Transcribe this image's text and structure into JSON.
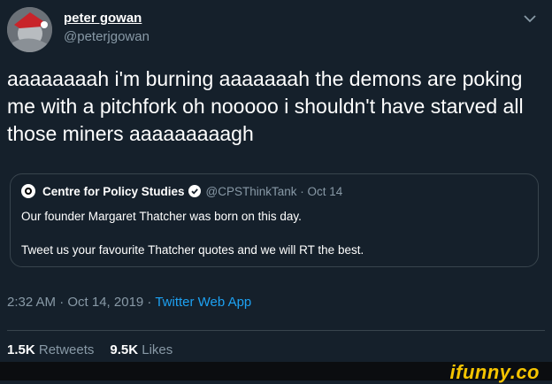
{
  "user": {
    "name": "peter gowan",
    "handle": "@peterjgowan"
  },
  "tweet": {
    "text": "aaaaaaaah i'm burning aaaaaaah the demons are poking me with a pitchfork oh nooooo i shouldn't have starved all those miners aaaaaaaaagh"
  },
  "quote": {
    "name": "Centre for Policy Studies",
    "meta": "@CPSThinkTank · Oct 14",
    "line1": "Our founder Margaret Thatcher was born on this day.",
    "line2": "Tweet us your favourite Thatcher quotes and we will RT the best."
  },
  "timestamp": "2:32 AM · Oct 14, 2019 · ",
  "source": "Twitter Web App",
  "stats": {
    "retweets_count": "1.5K",
    "retweets_label": "Retweets",
    "likes_count": "9.5K",
    "likes_label": "Likes"
  },
  "watermark": "ifunny.co",
  "colors": {
    "background": "#15202b",
    "muted": "#8899a6",
    "link": "#1da1f2",
    "watermark": "#f5c400"
  }
}
